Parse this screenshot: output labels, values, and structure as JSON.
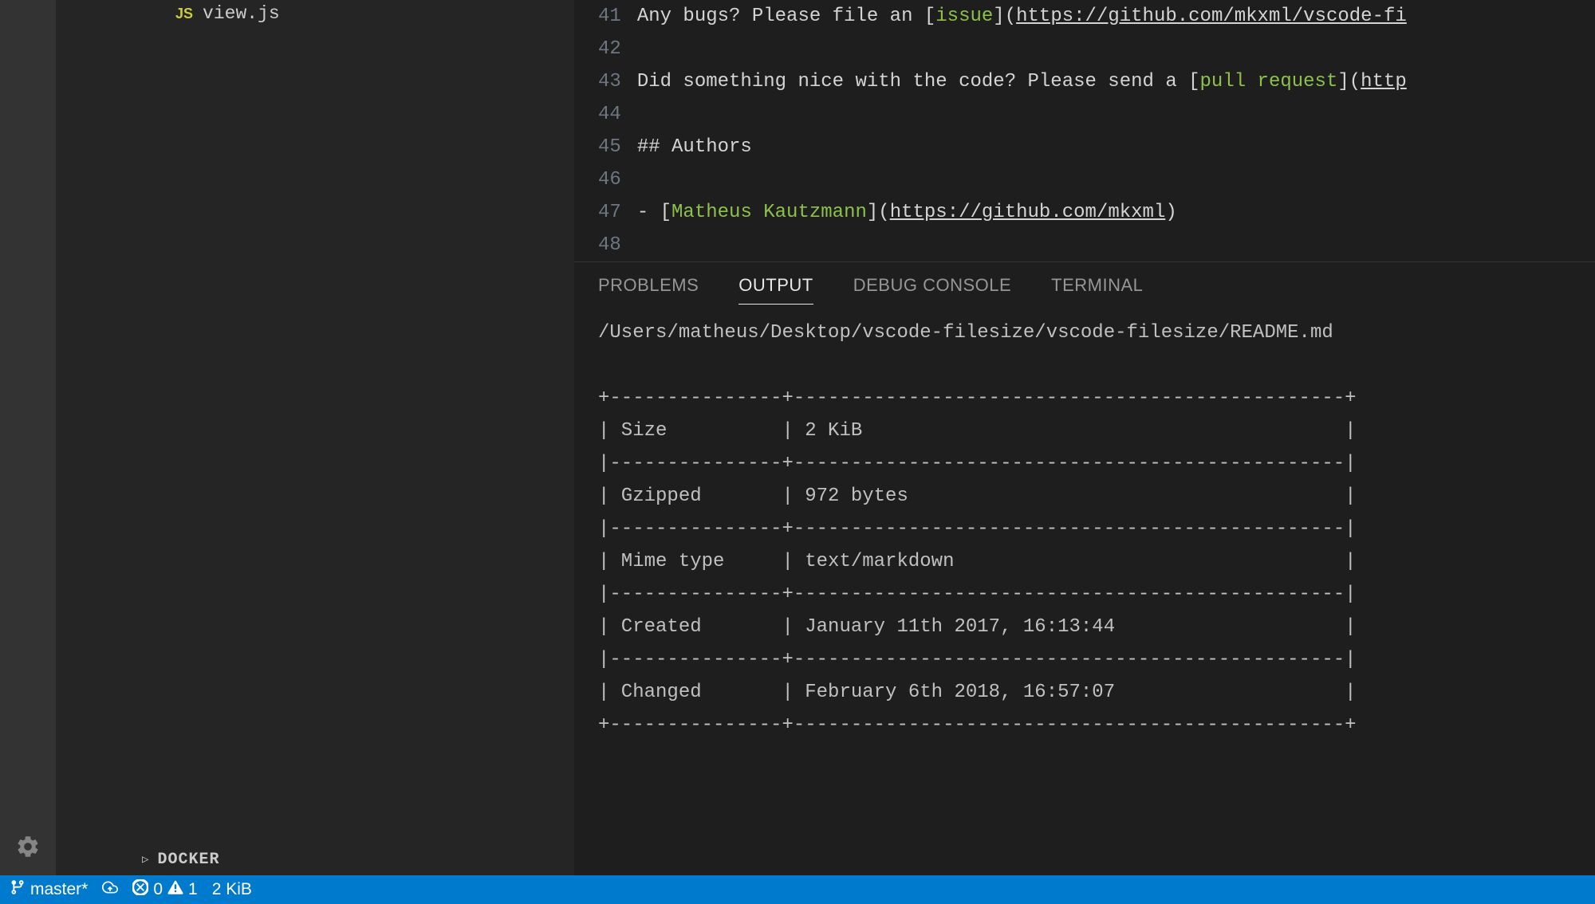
{
  "sidebar": {
    "file": {
      "icon_label": "JS",
      "name": "view.js"
    },
    "docker_label": "DOCKER"
  },
  "editor": {
    "lines": [
      {
        "num": "41",
        "segments": [
          {
            "t": "Any bugs? Please file an [",
            "c": "plain"
          },
          {
            "t": "issue",
            "c": "link-text"
          },
          {
            "t": "](",
            "c": "plain"
          },
          {
            "t": "https://github.com/mkxml/vscode-fi",
            "c": "link-url"
          }
        ]
      },
      {
        "num": "42",
        "segments": []
      },
      {
        "num": "43",
        "segments": [
          {
            "t": "Did something nice with the code? Please send a [",
            "c": "plain"
          },
          {
            "t": "pull request",
            "c": "link-text"
          },
          {
            "t": "](",
            "c": "plain"
          },
          {
            "t": "http",
            "c": "link-url"
          }
        ]
      },
      {
        "num": "44",
        "segments": []
      },
      {
        "num": "45",
        "segments": [
          {
            "t": "## Authors",
            "c": "heading"
          }
        ]
      },
      {
        "num": "46",
        "segments": []
      },
      {
        "num": "47",
        "segments": [
          {
            "t": "- [",
            "c": "plain"
          },
          {
            "t": "Matheus Kautzmann",
            "c": "link-text"
          },
          {
            "t": "](",
            "c": "plain"
          },
          {
            "t": "https://github.com/mkxml",
            "c": "link-url"
          },
          {
            "t": ")",
            "c": "plain"
          }
        ]
      },
      {
        "num": "48",
        "segments": []
      }
    ]
  },
  "panel": {
    "tabs": [
      "PROBLEMS",
      "OUTPUT",
      "DEBUG CONSOLE",
      "TERMINAL"
    ],
    "active_tab": 1,
    "output_path": "/Users/matheus/Desktop/vscode-filesize/vscode-filesize/README.md",
    "table_rows": [
      {
        "k": "Size",
        "v": "2 KiB"
      },
      {
        "k": "Gzipped",
        "v": "972 bytes"
      },
      {
        "k": "Mime type",
        "v": "text/markdown"
      },
      {
        "k": "Created",
        "v": "January 11th 2017, 16:13:44"
      },
      {
        "k": "Changed",
        "v": "February 6th 2018, 16:57:07"
      }
    ]
  },
  "statusbar": {
    "branch": "master*",
    "errors": "0",
    "warnings": "1",
    "filesize": "2 KiB"
  }
}
